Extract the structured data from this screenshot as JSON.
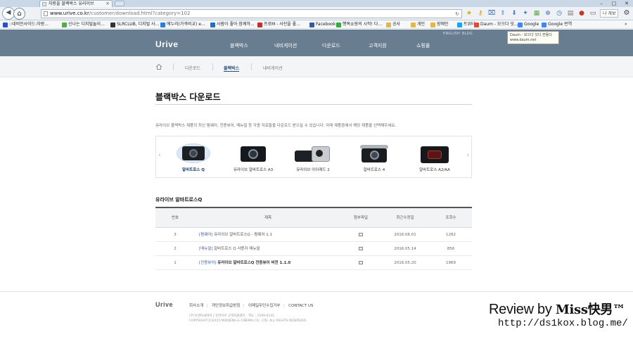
{
  "browser": {
    "tab_title": "자랑을 블랙박스 유라이브",
    "tab_close": "×",
    "url_host": "www.urive.co.kr",
    "url_path": "/customer/download.html?category=102",
    "profile_label": "나 개보",
    "window_controls": [
      "–",
      "□",
      "✕"
    ],
    "bookmarks": [
      {
        "label": "::네비인사이드:자랑...",
        "color": "#2a50c8"
      },
      {
        "label": "신나는 디지털놀이...",
        "color": "#5aa84e"
      },
      {
        "label": "SLRCLUB, 디지털 사...",
        "color": "#333333"
      },
      {
        "label": "에누리(가격비교) e...",
        "color": "#2c7fd6"
      },
      {
        "label": "사람이 좋아 함께하...",
        "color": "#1e6fd2"
      },
      {
        "label": "프로M - 사진을 좋...",
        "color": "#c0332b"
      },
      {
        "label": "Facebook",
        "color": "#3b5998"
      },
      {
        "label": "행복쇼핑의 시작! 다...",
        "color": "#38a845"
      },
      {
        "label": "공사",
        "color": "#e3b74a"
      },
      {
        "label": "개인",
        "color": "#e3b74a"
      },
      {
        "label": "장애인",
        "color": "#e3b74a"
      },
      {
        "label": "트위터",
        "color": "#1da1f2"
      },
      {
        "label": "Daum - 모으다 잇...",
        "color": "#e04a3a"
      },
      {
        "label": "Google",
        "color": "#4285f4"
      },
      {
        "label": "Google 번역",
        "color": "#4285f4"
      }
    ],
    "bookmarks_more": "»"
  },
  "tooltip": {
    "line1": "Daum - 모으다 잇다 흔들다",
    "line2": "www.daum.net"
  },
  "site": {
    "logo": "Urive",
    "nav": [
      "블랙박스",
      "내비게이션",
      "다운로드",
      "고객지원",
      "쇼핑몰"
    ],
    "util": [
      "ENGLISH",
      "BLOG"
    ],
    "breadcrumb": [
      "다운로드",
      "블랙박스",
      "내비게이션"
    ]
  },
  "main": {
    "title": "블랙박스 다운로드",
    "intro": "유라이브 블랙박스 제품의 최신 펌웨어, 전용뷰어, 매뉴얼 등 각종 자료들을 다운로드 받으실 수 있습니다. 아래 제품중에서 해당 제품을 선택해주세요.",
    "carousel_prev": "‹",
    "carousel_next": "›",
    "products": [
      {
        "name": "알바트로스 Q",
        "active": true
      },
      {
        "name": "유라이브 알바트로스 A3",
        "active": false
      },
      {
        "name": "유라이브 아이레드 2",
        "active": false
      },
      {
        "name": "알바트로스 4",
        "active": false
      },
      {
        "name": "알바트로스 A2/AA",
        "active": false
      }
    ],
    "section_title": "유라이브 알바트로스Q",
    "table": {
      "headers": [
        "번호",
        "제목",
        "첨부파일",
        "최근수정일",
        "조회수"
      ],
      "rows": [
        {
          "no": "3",
          "category": "[펌웨어]",
          "title": "유라이브 알바트로스Q - 펌웨어 1.1",
          "date": "2016.06.01",
          "hits": "1282"
        },
        {
          "no": "2",
          "category": "[매뉴얼]",
          "title": "알바트로스 Q 사용자 매뉴얼",
          "date": "2016.05.14",
          "hits": "856"
        },
        {
          "no": "1",
          "category": "[전용뷰어]",
          "title": "유라이브 알바트로스Q 전용뷰어 버전 1.1.0",
          "date": "2016.05.20",
          "hits": "1969"
        }
      ]
    }
  },
  "footer": {
    "logo": "Urive",
    "links": [
      "회사소개",
      "개인정보취급방침",
      "이메일무단수집거부",
      "CONTACT US"
    ],
    "info1": "(주)유앤비씨대마 | 유라이브 고객지원센터 : TEL : 1599-0141",
    "info2": "COPYRIGHT(C)2015 MIDDENS & CINEMA CO., LTD. ALL RIGHTS RESERVED."
  },
  "watermark": {
    "review": "Review by ",
    "author": "Miss快男™",
    "url": "http://ds1kox.blog.me/"
  }
}
